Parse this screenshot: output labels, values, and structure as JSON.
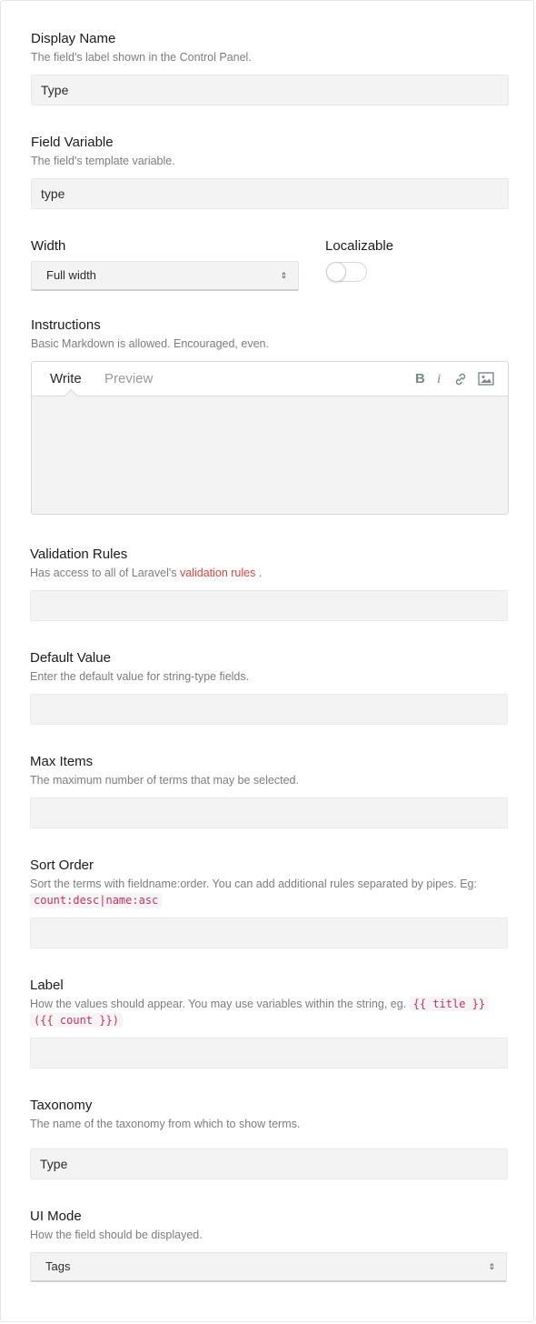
{
  "display_name": {
    "label": "Display Name",
    "help": "The field's label shown in the Control Panel.",
    "value": "Type"
  },
  "field_variable": {
    "label": "Field Variable",
    "help": "The field's template variable.",
    "value": "type"
  },
  "width": {
    "label": "Width",
    "selected": "Full width"
  },
  "localizable": {
    "label": "Localizable",
    "enabled": false
  },
  "instructions": {
    "label": "Instructions",
    "help": "Basic Markdown is allowed. Encouraged, even.",
    "tabs": {
      "write": "Write",
      "preview": "Preview"
    },
    "active_tab": "Write",
    "toolbar": {
      "bold": "B",
      "italic": "i"
    },
    "value": ""
  },
  "validation_rules": {
    "label": "Validation Rules",
    "help_prefix": "Has access to all of Laravel's",
    "help_link": "validation rules",
    "help_suffix": ".",
    "value": ""
  },
  "default_value": {
    "label": "Default Value",
    "help": "Enter the default value for string-type fields.",
    "value": ""
  },
  "max_items": {
    "label": "Max Items",
    "help": "The maximum number of terms that may be selected.",
    "value": ""
  },
  "sort_order": {
    "label": "Sort Order",
    "help": "Sort the terms with fieldname:order. You can add additional rules separated by pipes. Eg:",
    "code": "count:desc|name:asc",
    "value": ""
  },
  "label_field": {
    "label": "Label",
    "help": "How the values should appear. You may use variables within the string, eg.",
    "code1": "{{ title }}",
    "code2": "({{ count }})",
    "value": ""
  },
  "taxonomy": {
    "label": "Taxonomy",
    "help": "The name of the taxonomy from which to show terms.",
    "value": "Type"
  },
  "ui_mode": {
    "label": "UI Mode",
    "help": "How the field should be displayed.",
    "selected": "Tags"
  },
  "colors": {
    "link": "#e2443b",
    "code_text": "#cf2f5b",
    "input_bg": "#f3f3f3"
  }
}
